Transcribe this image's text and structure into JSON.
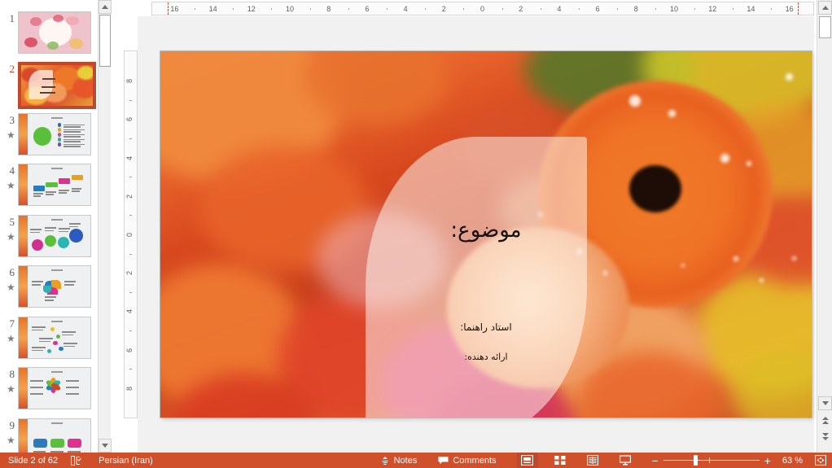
{
  "app": {
    "name": "Microsoft PowerPoint",
    "accent_color": "#d0502c",
    "selected_thumb_border": "#c0492b"
  },
  "thumbnails": {
    "pane_name": "slide-thumbnail-pane",
    "slides": [
      {
        "number": "1",
        "animated": false,
        "selected": false,
        "style": "title-pink-floral"
      },
      {
        "number": "2",
        "animated": false,
        "selected": true,
        "style": "title-orange-flowers"
      },
      {
        "number": "3",
        "animated": true,
        "selected": false,
        "style": "content-circle-diagram"
      },
      {
        "number": "4",
        "animated": true,
        "selected": false,
        "style": "content-steps-bars"
      },
      {
        "number": "5",
        "animated": true,
        "selected": false,
        "style": "content-bubbles"
      },
      {
        "number": "6",
        "animated": true,
        "selected": false,
        "style": "content-pinwheel"
      },
      {
        "number": "7",
        "animated": true,
        "selected": false,
        "style": "content-dot-list"
      },
      {
        "number": "8",
        "animated": true,
        "selected": false,
        "style": "content-flower-petals"
      },
      {
        "number": "9",
        "animated": true,
        "selected": false,
        "style": "content-callouts"
      }
    ],
    "animation_marker": "★",
    "scrollbar": {
      "up_arrow": "scroll-up",
      "down_arrow": "scroll-down"
    }
  },
  "ruler": {
    "horizontal": {
      "name": "horizontal-ruler",
      "labels": [
        "16",
        "14",
        "12",
        "10",
        "8",
        "6",
        "4",
        "2",
        "0",
        "2",
        "4",
        "6",
        "8",
        "10",
        "12",
        "14",
        "16"
      ],
      "unit": "cm"
    },
    "vertical": {
      "name": "vertical-ruler",
      "labels": [
        "8",
        "6",
        "4",
        "2",
        "0",
        "2",
        "4",
        "6",
        "8"
      ],
      "unit": "cm"
    }
  },
  "slide": {
    "name": "slide-editing-canvas",
    "background_description": "orange gerbera daisies, peach rose and yellow flowers bouquet",
    "overlay_shape": "teardrop",
    "text": {
      "subject_label": "موضوع:",
      "advisor_label": "استاد راهنما:",
      "presenter_label": "ارائه دهنده:"
    }
  },
  "status_bar": {
    "slide_indicator": "Slide 2 of 62",
    "language": "Persian (Iran)",
    "notes_label": "Notes",
    "comments_label": "Comments",
    "zoom_level": "63 %",
    "views": [
      {
        "name": "normal-view",
        "active": true
      },
      {
        "name": "slide-sorter-view",
        "active": false
      },
      {
        "name": "reading-view",
        "active": false
      },
      {
        "name": "slide-show-view",
        "active": false
      }
    ],
    "zoom_out_label": "−",
    "zoom_in_label": "+",
    "fit_slide_label": "fit-to-window"
  }
}
